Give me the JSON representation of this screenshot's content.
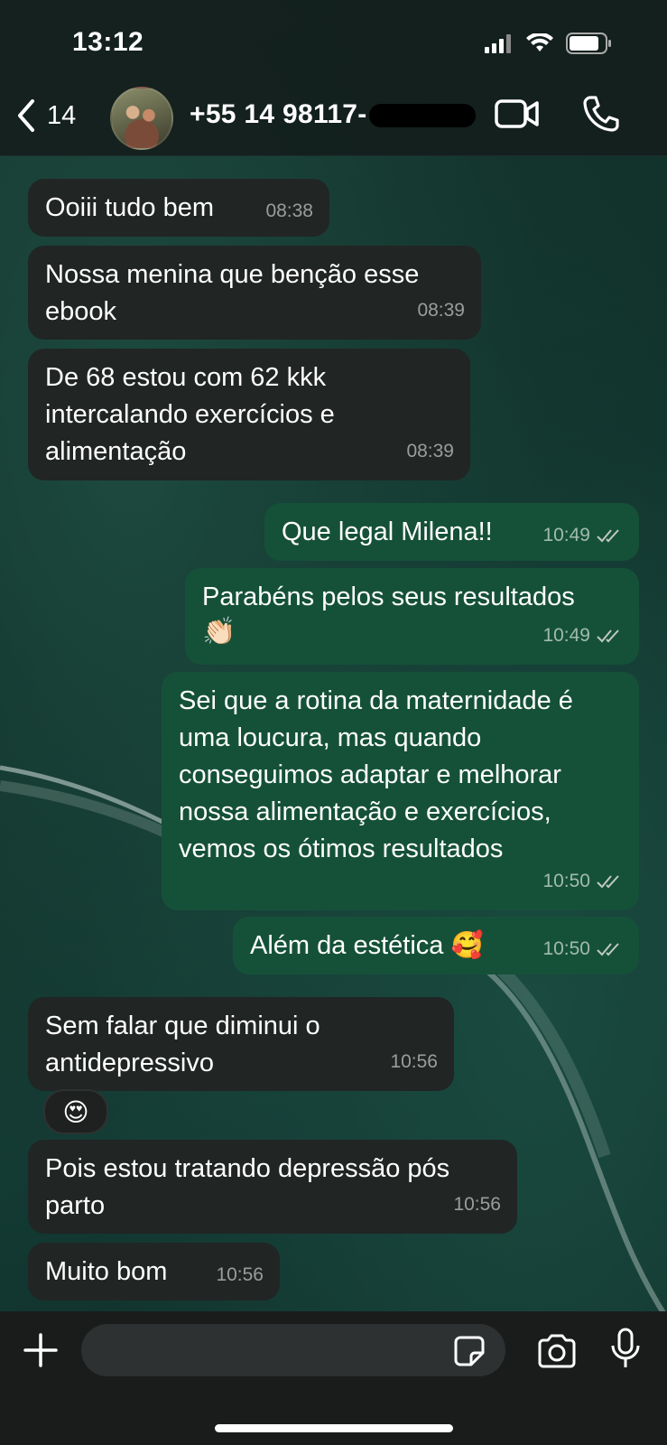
{
  "status_bar": {
    "time": "13:12",
    "signal_icon": "cellular-signal-icon",
    "wifi_icon": "wifi-icon",
    "battery_icon": "battery-icon"
  },
  "header": {
    "back_count": "14",
    "contact_name": "+55 14 98117-",
    "back_icon": "chevron-left-icon",
    "video_icon": "video-camera-icon",
    "call_icon": "phone-icon"
  },
  "messages": [
    {
      "direction": "in",
      "text": "Ooiii tudo bem",
      "time": "08:38"
    },
    {
      "direction": "in",
      "text": "Nossa menina que benção esse ebook",
      "time": "08:39"
    },
    {
      "direction": "in",
      "text": "De 68 estou com 62 kkk intercalando exercícios e alimentação",
      "time": "08:39"
    },
    {
      "direction": "out",
      "text": "Que legal Milena!!",
      "time": "10:49",
      "status": "read"
    },
    {
      "direction": "out",
      "text": "Parabéns pelos seus resultados",
      "emoji": "👏🏻",
      "time": "10:49",
      "status": "read"
    },
    {
      "direction": "out",
      "text": "Sei que a rotina da maternidade é uma loucura, mas quando conseguimos adaptar e melhorar nossa alimentação e exercícios, vemos os ótimos resultados",
      "time": "10:50",
      "status": "read"
    },
    {
      "direction": "out",
      "text": "Além da estética 🥰",
      "time": "10:50",
      "status": "read"
    },
    {
      "direction": "in",
      "text": "Sem falar que diminui o antidepressivo",
      "time": "10:56",
      "reaction": "😍"
    },
    {
      "direction": "in",
      "text": "Pois estou tratando depressão pós parto",
      "time": "10:56"
    },
    {
      "direction": "in",
      "text": "Muito bom",
      "time": "10:56"
    }
  ],
  "input_bar": {
    "placeholder": "",
    "plus_icon": "plus-icon",
    "sticker_icon": "sticker-icon",
    "camera_icon": "camera-icon",
    "mic_icon": "microphone-icon"
  },
  "colors": {
    "incoming_bubble": "#212524",
    "outgoing_bubble": "#155139",
    "header": "#141e1c"
  }
}
